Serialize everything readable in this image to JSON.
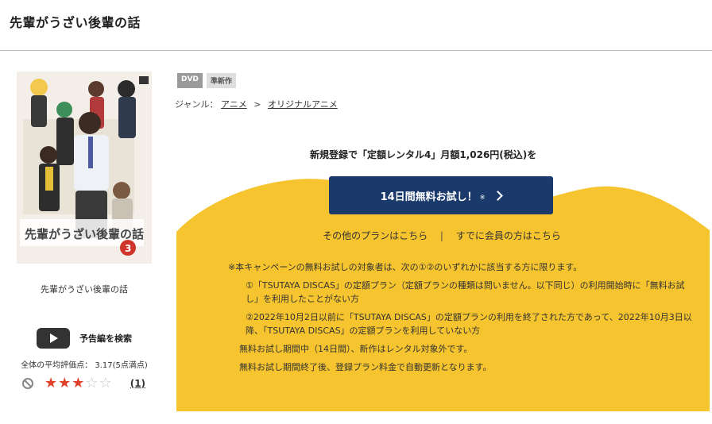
{
  "header": {
    "title": "先輩がうざい後輩の話"
  },
  "product": {
    "name": "先輩がうざい後輩の話",
    "cover_alt": "先輩がうざい後輩の話 DVD Vol.3",
    "cover_number": "3",
    "cover_logo": "先輩がうざい後輩の話"
  },
  "trailer": {
    "label": "予告編を検索"
  },
  "rating": {
    "average_text": "全体の平均評価点： 3.17(5点満点)",
    "stars_filled": 3,
    "stars_total": 5,
    "review_count": "(1)"
  },
  "badges": [
    "DVD",
    "準新作"
  ],
  "genre": {
    "label": "ジャンル：",
    "items": [
      "アニメ",
      "オリジナルアニメ"
    ],
    "separator": ">"
  },
  "promo": {
    "heading": "新規登録で「定額レンタル4」月額1,026円(税込)を",
    "cta_label": "14日間無料お試し！",
    "cta_note": "※",
    "link_other_plans": "その他のプランはこちら",
    "link_divider": "|",
    "link_members": "すでに会員の方はこちら",
    "accent_color": "#f6c42e",
    "cta_color": "#1a3a6b"
  },
  "notes": {
    "main": "※本キャンペーンの無料お試しの対象者は、次の①②のいずれかに該当する方に限ります。",
    "item1": "①「TSUTAYA DISCAS」の定額プラン（定額プランの種類は問いません。以下同じ）の利用開始時に「無料お試し」を利用したことがない方",
    "item2": "②2022年10月2日以前に「TSUTAYA DISCAS」の定額プランの利用を終了された方であって、2022年10月3日以降、「TSUTAYA DISCAS」の定額プランを利用していない方",
    "trial_period": "無料お試し期間中（14日間）、新作はレンタル対象外です。",
    "auto_renew": "無料お試し期間終了後、登録プラン料金で自動更新となります。"
  }
}
